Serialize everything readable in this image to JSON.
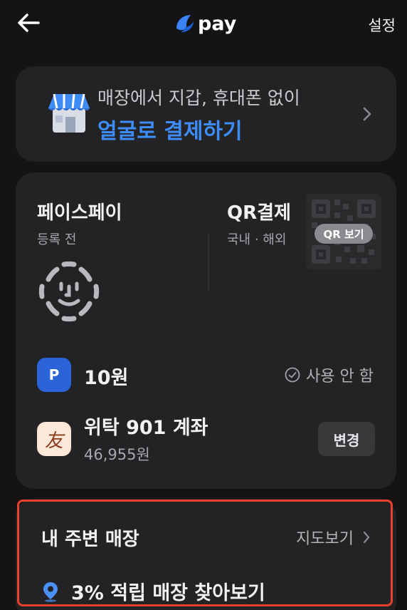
{
  "header": {
    "logo_text": "pay",
    "settings_label": "설정"
  },
  "promo": {
    "line1": "매장에서 지갑, 휴대폰 없이",
    "line2": "얼굴로 결제하기"
  },
  "face_pay": {
    "title": "페이스페이",
    "status": "등록 전"
  },
  "qr_pay": {
    "title": "QR결제",
    "scope": "국내 · 해외",
    "badge": "QR 보기"
  },
  "point": {
    "icon_letter": "P",
    "amount": "10원",
    "toggle_label": "사용 안 함"
  },
  "account": {
    "icon_char": "友",
    "name": "위탁 901 계좌",
    "balance": "46,955원",
    "change_label": "변경"
  },
  "stores": {
    "title": "내 주변 매장",
    "map_label": "지도보기",
    "item_label": "3% 적립 매장 찾아보기"
  },
  "colors": {
    "background": "#141416",
    "card": "#232325",
    "accent_blue": "#3d8cf8",
    "highlight_red": "#e8402c"
  }
}
